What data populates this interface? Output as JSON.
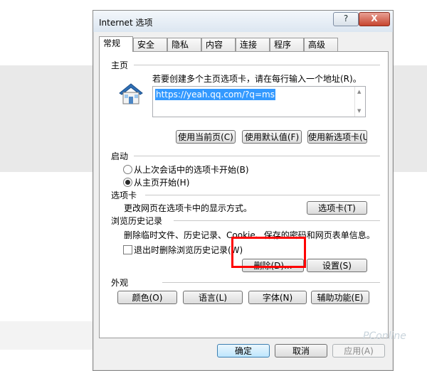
{
  "window": {
    "title": "Internet 选项",
    "help_label": "?",
    "close_label": "X"
  },
  "tabs": [
    "常规",
    "安全",
    "隐私",
    "内容",
    "连接",
    "程序",
    "高级"
  ],
  "home": {
    "group_label": "主页",
    "description": "若要创建多个主页选项卡，请在每行输入一个地址(R)。",
    "url": "https://yeah.qq.com/?q=ms",
    "btn_current": "使用当前页(C)",
    "btn_default": "使用默认值(F)",
    "btn_newtab": "使用新选项卡(U)"
  },
  "startup": {
    "group_label": "启动",
    "option_last": "从上次会话中的选项卡开始(B)",
    "option_home": "从主页开始(H)"
  },
  "tabsection": {
    "group_label": "选项卡",
    "description": "更改网页在选项卡中的显示方式。",
    "btn": "选项卡(T)"
  },
  "history": {
    "group_label": "浏览历史记录",
    "description": "删除临时文件、历史记录、Cookie、保存的密码和网页表单信息。",
    "checkbox": "退出时删除浏览历史记录(W)",
    "btn_delete": "删除(D)...",
    "btn_settings": "设置(S)"
  },
  "appearance": {
    "group_label": "外观",
    "btn_colors": "颜色(O)",
    "btn_languages": "语言(L)",
    "btn_fonts": "字体(N)",
    "btn_accessibility": "辅助功能(E)"
  },
  "footer": {
    "ok": "确定",
    "cancel": "取消",
    "apply": "应用(A)"
  },
  "watermark": "PConline"
}
